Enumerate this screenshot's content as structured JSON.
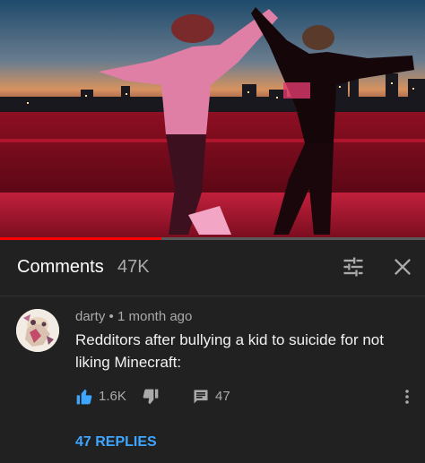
{
  "video": {
    "progress_fraction": 0.38
  },
  "header": {
    "title": "Comments",
    "count": "47K"
  },
  "comment": {
    "author": "darty",
    "separator": "•",
    "time": "1 month ago",
    "text": "Redditors after bullying a kid to suicide for not liking Minecraft:",
    "likes": "1.6K",
    "reply_count": "47",
    "replies_label": "47 REPLIES"
  },
  "colors": {
    "accent": "#3ea6ff",
    "progress": "#ff0000",
    "background": "#212121",
    "secondary_text": "#aaaaaa"
  }
}
